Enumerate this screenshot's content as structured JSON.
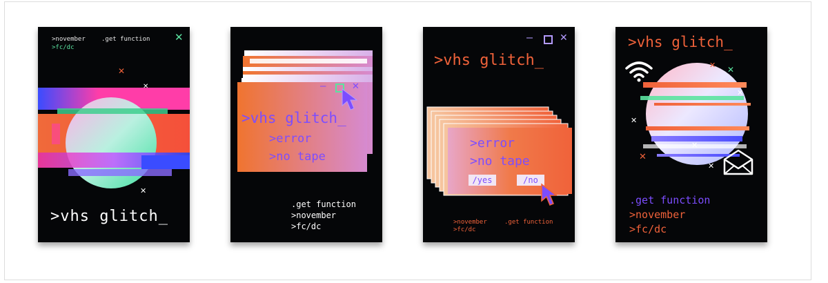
{
  "colors": {
    "poster_bg": "#050608",
    "orange": "#f0623a",
    "purple": "#7c4dff",
    "green": "#5be3a0",
    "pink": "#ff3da8",
    "lavender": "#c8b4ff"
  },
  "posters": [
    {
      "top_lines": [
        ">november",
        ".get function",
        ">fc/dc"
      ],
      "title": ">vhs glitch_"
    },
    {
      "title": ">vhs glitch_",
      "lines": [
        ">error",
        ">no tape"
      ],
      "footer": [
        ".get function",
        ">november",
        ">fc/dc"
      ]
    },
    {
      "title": ">vhs glitch_",
      "lines": [
        ">error",
        ">no tape"
      ],
      "buttons": [
        "/yes",
        "/no"
      ],
      "footer": [
        ">november",
        ".get function",
        ">fc/dc"
      ]
    },
    {
      "title": ">vhs glitch_",
      "footer": [
        ".get function",
        ">november",
        ">fc/dc"
      ],
      "icons": [
        "wifi-icon",
        "envelope-icon"
      ]
    }
  ]
}
